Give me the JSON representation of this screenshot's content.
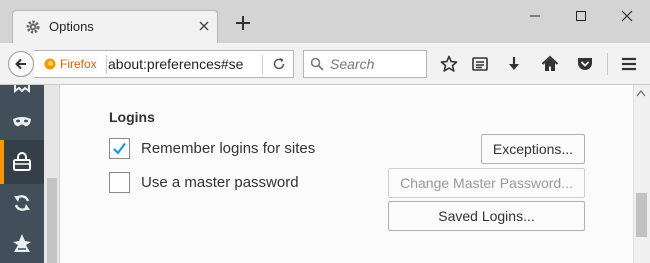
{
  "tab": {
    "title": "Options"
  },
  "navbar": {
    "identity_label": "Firefox",
    "url": "about:preferences#se",
    "search_placeholder": "Search"
  },
  "content": {
    "section_heading": "Logins",
    "remember_logins": {
      "label_prefix": "R",
      "label_accel": "",
      "label": "Remember logins for sites",
      "checked": true
    },
    "master_password": {
      "label": "Use a master password",
      "checked": false
    },
    "buttons": {
      "exceptions": "Exceptions...",
      "change_master": "Change Master Password...",
      "saved_logins": "Saved Logins..."
    }
  },
  "colors": {
    "accent": "#0996f8",
    "sidebar": "#424f5a",
    "sidebar_active": "#ff9500",
    "identity": "#e66000"
  }
}
